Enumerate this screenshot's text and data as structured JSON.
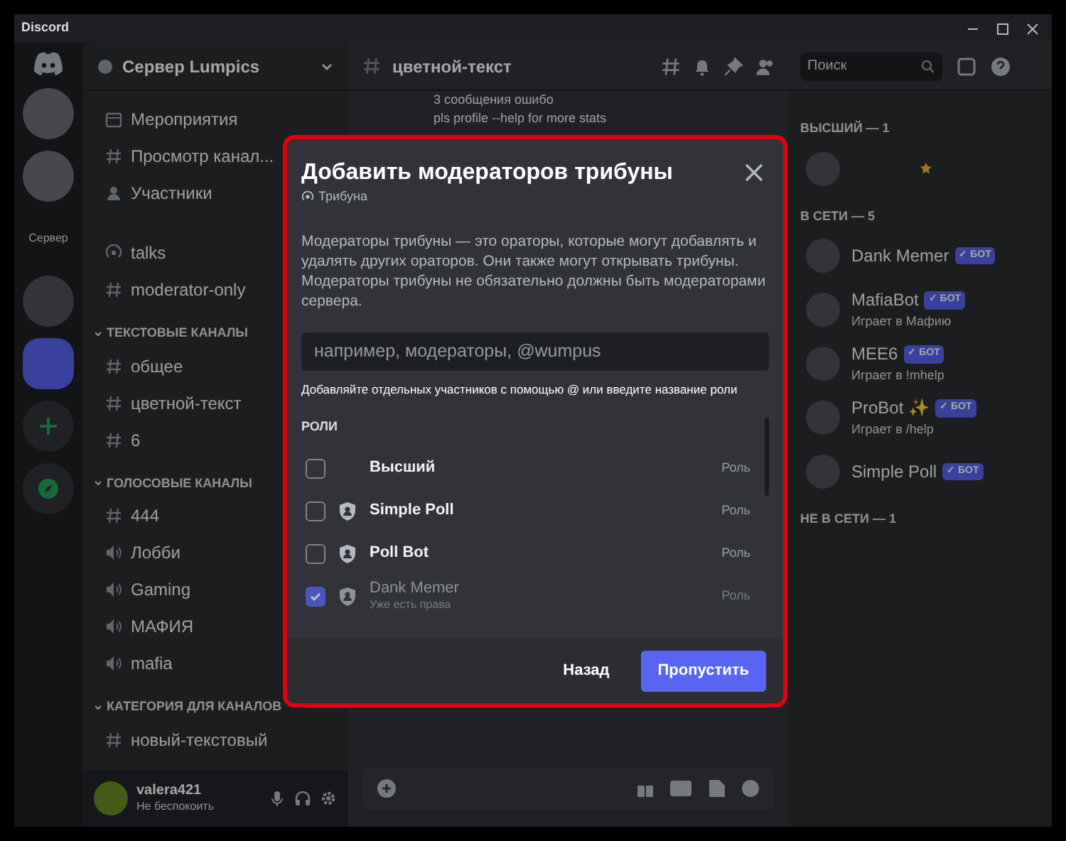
{
  "window": {
    "title": "Discord"
  },
  "servers": [
    {
      "kind": "logo"
    },
    {
      "kind": "avatar"
    },
    {
      "kind": "avatar"
    },
    {
      "kind": "text",
      "label": "Сервер"
    },
    {
      "kind": "blank"
    },
    {
      "kind": "tile"
    },
    {
      "kind": "add"
    },
    {
      "kind": "explore"
    }
  ],
  "channel_sidebar": {
    "server_name": "Сервер Lumpics",
    "items": [
      {
        "kind": "events",
        "label": "Мероприятия"
      },
      {
        "kind": "browse",
        "label": "Просмотр канал..."
      },
      {
        "kind": "members",
        "label": "Участники"
      },
      {
        "kind": "gap"
      },
      {
        "kind": "stage",
        "label": "talks"
      },
      {
        "kind": "text",
        "label": "moderator-only"
      },
      {
        "kind": "category",
        "label": "ТЕКСТОВЫЕ КАНАЛЫ"
      },
      {
        "kind": "text",
        "label": "общее"
      },
      {
        "kind": "text",
        "label": "цветной-текст"
      },
      {
        "kind": "text",
        "label": "6"
      },
      {
        "kind": "category",
        "label": "ГОЛОСОВЫЕ КАНАЛЫ"
      },
      {
        "kind": "text",
        "label": "444"
      },
      {
        "kind": "voice",
        "label": "Лобби"
      },
      {
        "kind": "voice",
        "label": "Gaming"
      },
      {
        "kind": "voice",
        "label": "МАФИЯ"
      },
      {
        "kind": "voice",
        "label": "mafia"
      },
      {
        "kind": "category",
        "label": "КАТЕГОРИЯ ДЛЯ КАНАЛОВ"
      },
      {
        "kind": "text",
        "label": "новый-текстовый"
      }
    ]
  },
  "user_panel": {
    "name": "valera421",
    "status": "Не беспокоить"
  },
  "chat_header": {
    "channel": "цветной-текст",
    "search_placeholder": "Поиск"
  },
  "chat_messages": [
    "3 сообщения ошибо",
    "pls profile --help for more stats"
  ],
  "members": [
    {
      "title": "ВЫСШИЙ — 1",
      "members": [
        {
          "kind": "starred"
        }
      ]
    },
    {
      "title": "В СЕТИ — 5",
      "members": [
        {
          "kind": "bot",
          "name": "Dank Memer",
          "tag": "✓ БОТ"
        },
        {
          "kind": "bot",
          "name": "MafiaBot",
          "activity": "Играет в Мафию",
          "tag": "✓ БОТ"
        },
        {
          "kind": "bot",
          "name": "MEE6",
          "activity": "Играет в !mhelp",
          "tag": "✓ БОТ"
        },
        {
          "kind": "bot",
          "name": "ProBot ✨",
          "activity": "Играет в /help",
          "tag": "✓ БОТ"
        },
        {
          "kind": "bot",
          "name": "Simple Poll",
          "tag": "✓ БОТ"
        }
      ]
    },
    {
      "title": "НЕ В СЕТИ — 1"
    }
  ],
  "dialog": {
    "title": "Добавить модераторов трибуны",
    "subtitle": "Трибуна",
    "description": "Модераторы трибуны — это ораторы, которые могут добавлять и удалять других ораторов. Они также могут открывать трибуны. Модераторы трибуны не обязательно должны быть модераторами сервера.",
    "search_placeholder": "например, модераторы, @wumpus",
    "hint": "Добавляйте отдельных участников с помощью @ или введите название роли",
    "section": "РОЛИ",
    "roles": [
      {
        "kind": "plain",
        "name": "Высший",
        "type": "Роль",
        "checked": false,
        "disabled": false
      },
      {
        "kind": "shield",
        "name": "Simple Poll",
        "type": "Роль",
        "checked": false,
        "disabled": false
      },
      {
        "kind": "shield",
        "name": "Poll Bot",
        "type": "Роль",
        "checked": false,
        "disabled": false
      },
      {
        "kind": "shield",
        "name": "Dank Memer",
        "note": "Уже есть права",
        "type": "Роль",
        "checked": true,
        "disabled": true
      }
    ],
    "back": "Назад",
    "skip": "Пропустить"
  }
}
